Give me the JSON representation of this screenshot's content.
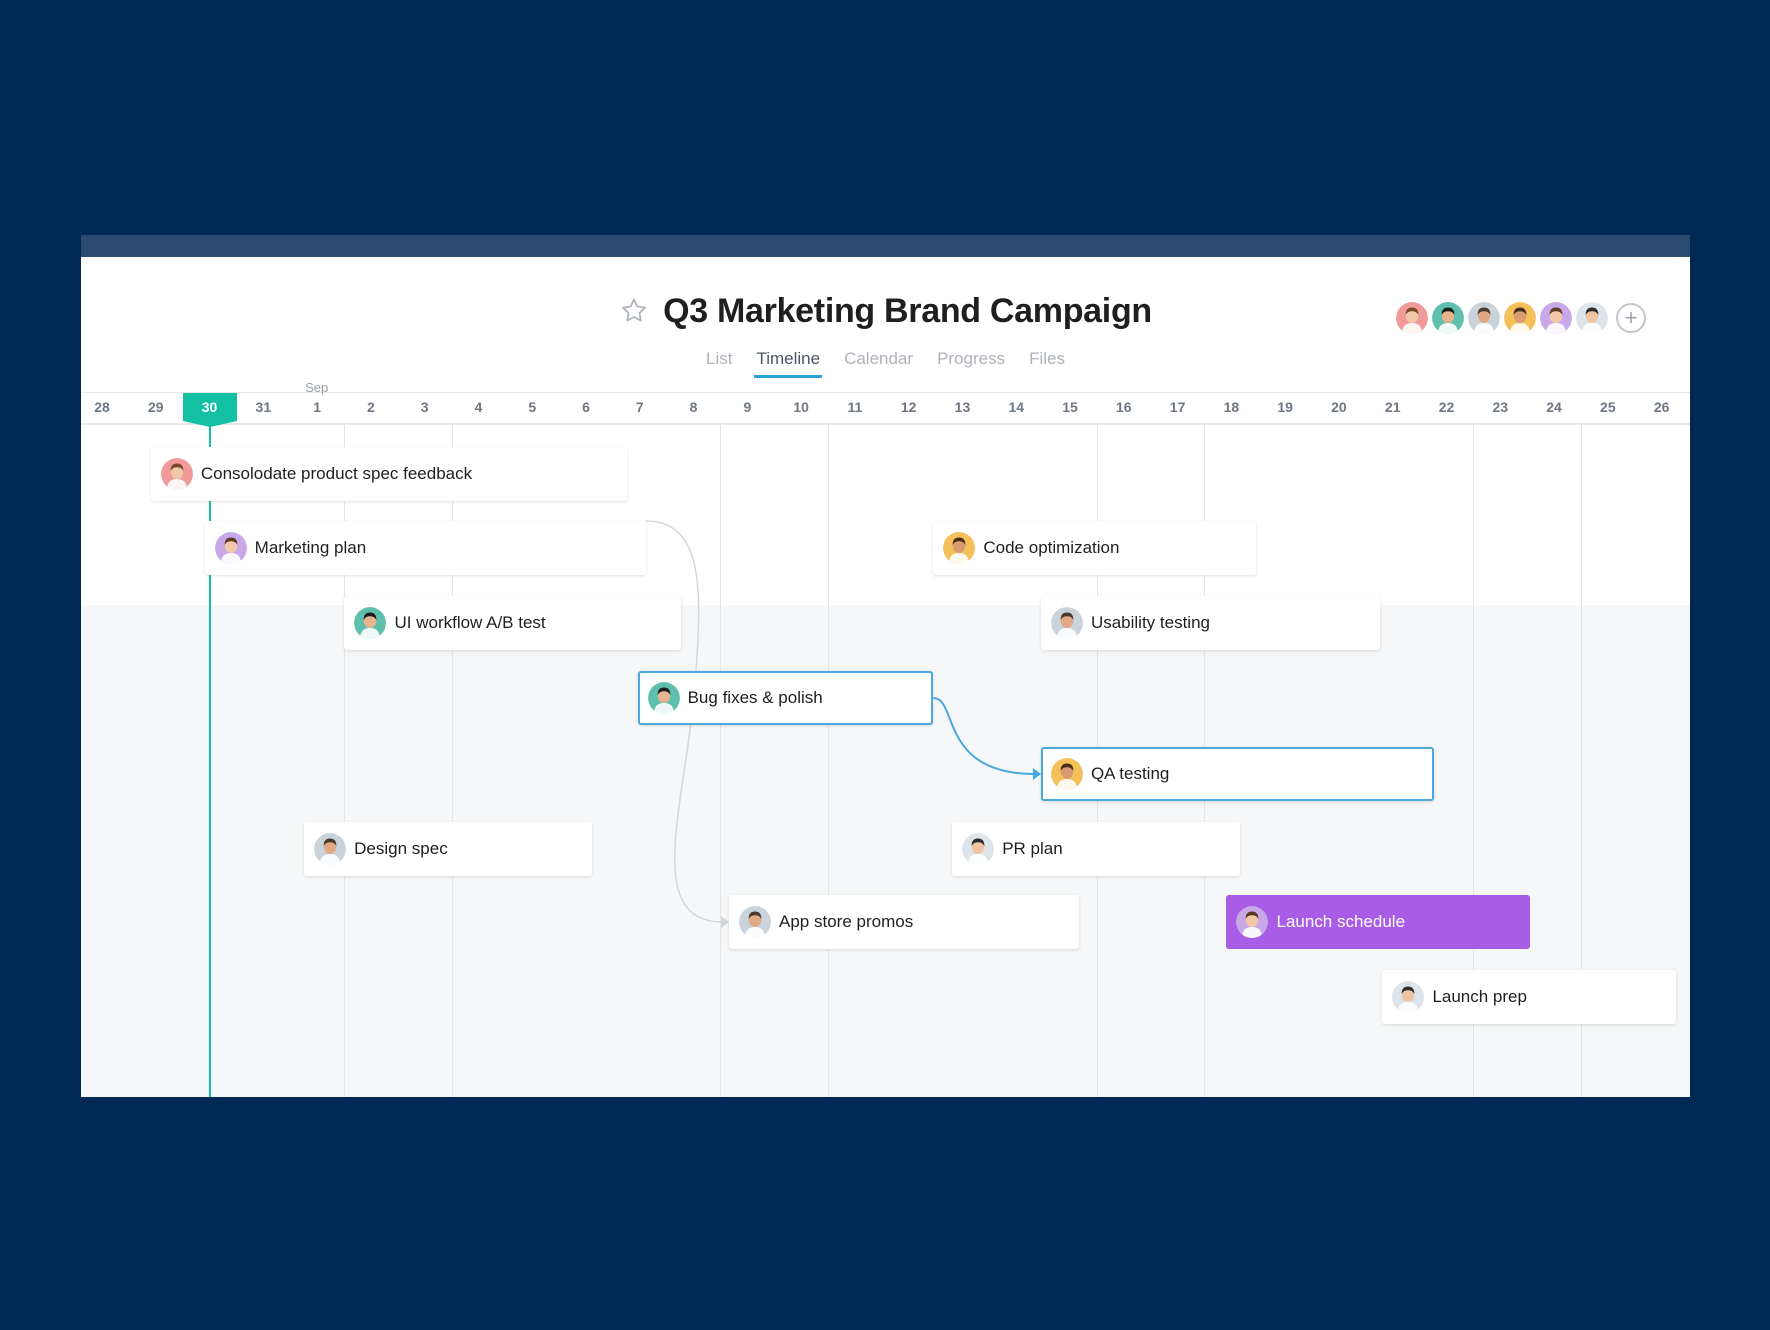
{
  "project": {
    "title": "Q3 Marketing Brand Campaign",
    "favorite_icon": "star-icon"
  },
  "members": {
    "avatars": [
      {
        "bg": "#f19a9a",
        "skin": "#f0c8a8",
        "hair": "#7a4a2a"
      },
      {
        "bg": "#5fbfad",
        "skin": "#e8b48f",
        "hair": "#1e1e1e"
      },
      {
        "bg": "#c9d3dc",
        "skin": "#e0a883",
        "hair": "#4a3a2e"
      },
      {
        "bg": "#f4c05a",
        "skin": "#d99b72",
        "hair": "#4a2c1a"
      },
      {
        "bg": "#c8a8e8",
        "skin": "#f1c9a9",
        "hair": "#5c3a24"
      },
      {
        "bg": "#dde4ea",
        "skin": "#eec4a2",
        "hair": "#2c2c2c"
      }
    ],
    "add_icon": "plus-icon",
    "add_label": "+"
  },
  "tabs": [
    {
      "label": "List",
      "active": false
    },
    {
      "label": "Timeline",
      "active": true
    },
    {
      "label": "Calendar",
      "active": false
    },
    {
      "label": "Progress",
      "active": false
    },
    {
      "label": "Files",
      "active": false
    }
  ],
  "timeline": {
    "month_label": "Sep",
    "days": [
      "28",
      "29",
      "30",
      "31",
      "1",
      "2",
      "3",
      "4",
      "5",
      "6",
      "7",
      "8",
      "9",
      "10",
      "11",
      "12",
      "13",
      "14",
      "15",
      "16",
      "17",
      "18",
      "19",
      "20",
      "21",
      "22",
      "23",
      "24",
      "25",
      "26"
    ],
    "today": "30",
    "colors": {
      "accent": "#14c0a3",
      "selected": "#4aa8dd",
      "purple": "#a95ce5",
      "tab_underline": "#29a3d8"
    }
  },
  "tasks": [
    {
      "label": "Consolodate product spec feedback",
      "avatar": 0,
      "start": "29",
      "end": "6",
      "style": "default"
    },
    {
      "label": "Marketing plan",
      "avatar": 4,
      "start": "30",
      "end": "7",
      "style": "default"
    },
    {
      "label": "UI workflow A/B test",
      "avatar": 1,
      "start": "1",
      "end": "7",
      "style": "default"
    },
    {
      "label": "Code optimization",
      "avatar": 3,
      "start": "12",
      "end": "18",
      "style": "default"
    },
    {
      "label": "Usability testing",
      "avatar": 2,
      "start": "14",
      "end": "20",
      "style": "default"
    },
    {
      "label": "Bug fixes & polish",
      "avatar": 1,
      "start": "7",
      "end": "12",
      "style": "selected"
    },
    {
      "label": "QA testing",
      "avatar": 3,
      "start": "14",
      "end": "21",
      "style": "selected"
    },
    {
      "label": "Design spec",
      "avatar": 2,
      "start": "31",
      "end": "6",
      "style": "default"
    },
    {
      "label": "PR plan",
      "avatar": 5,
      "start": "12",
      "end": "18",
      "style": "default"
    },
    {
      "label": "App store promos",
      "avatar": 2,
      "start": "8",
      "end": "15",
      "style": "default"
    },
    {
      "label": "Launch schedule",
      "avatar": 4,
      "start": "18",
      "end": "23",
      "style": "purple"
    },
    {
      "label": "Launch prep",
      "avatar": 5,
      "start": "20",
      "end": "26",
      "style": "default"
    }
  ],
  "dependencies": [
    {
      "from": "Marketing plan",
      "to": "App store promos"
    },
    {
      "from": "Bug fixes & polish",
      "to": "QA testing"
    }
  ]
}
